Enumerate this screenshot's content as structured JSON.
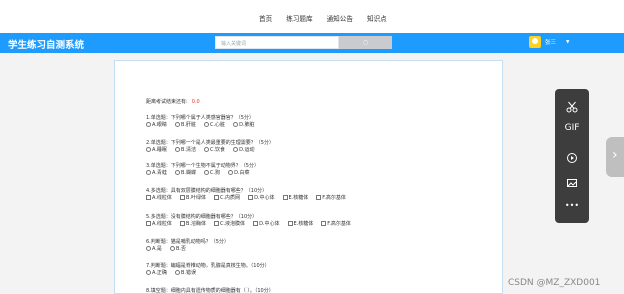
{
  "nav": [
    "首页",
    "练习题库",
    "通知公告",
    "知识点"
  ],
  "brand": "学生练习自测系统",
  "search": {
    "placeholder": "输入关键词",
    "button": "○"
  },
  "user": {
    "name": "张三",
    "caret": "▼"
  },
  "exam": {
    "remain_label": "距离考试结束还有:",
    "remain_value": "0.0",
    "questions": [
      {
        "text": "1.单选题：下列哪个属于人类感官器官？（5分）",
        "type": "radio",
        "options": [
          "A.眼睛",
          "B.肝脏",
          "C.心脏",
          "D.肺脏"
        ]
      },
      {
        "text": "2.单选题：下列哪一个是人类最重要的生理需要？（5分）",
        "type": "radio",
        "options": [
          "A.睡眠",
          "B.清洁",
          "C.饮食",
          "D.运动"
        ]
      },
      {
        "text": "3.单选题：下列哪一个生物不属于动物界？（5分）",
        "type": "radio",
        "options": [
          "A.青蛙",
          "B.蝴蝶",
          "C.狗",
          "D.白菜"
        ]
      },
      {
        "text": "4.多选题：具有双层膜结构的细胞器有哪些？（10分）",
        "type": "checkbox",
        "options": [
          "A.线粒体",
          "B.叶绿体",
          "C.内质网",
          "D.中心体",
          "E.核糖体",
          "F.高尔基体"
        ]
      },
      {
        "text": "5.多选题：没有膜结构的细胞器有哪些？（10分）",
        "type": "checkbox",
        "options": [
          "A.线粒体",
          "B.溶酶体",
          "C.液泡膜体",
          "D.中心体",
          "E.核糖体",
          "F.高尔基体"
        ]
      },
      {
        "text": "6.判断题：猫是哺乳动物吗？（5分）",
        "type": "radio",
        "options": [
          "A.是",
          "B.否"
        ]
      },
      {
        "text": "7.判断题：蝙蝠是脊椎动物，乳腺是真核生物。（10分）",
        "type": "radio",
        "options": [
          "A.正确",
          "B.错误"
        ]
      },
      {
        "text": "8.填空题：细胞内具有遗传物质的细胞器有（    ）。（10分）",
        "type": "none",
        "options": []
      }
    ]
  },
  "toolbar": {
    "tools": [
      "scissors-icon",
      "gif-icon",
      "video-icon",
      "image-icon",
      "more-icon"
    ],
    "gif_label": "GIF",
    "more_label": "•••"
  },
  "watermark": "CSDN @MZ_ZXD001"
}
